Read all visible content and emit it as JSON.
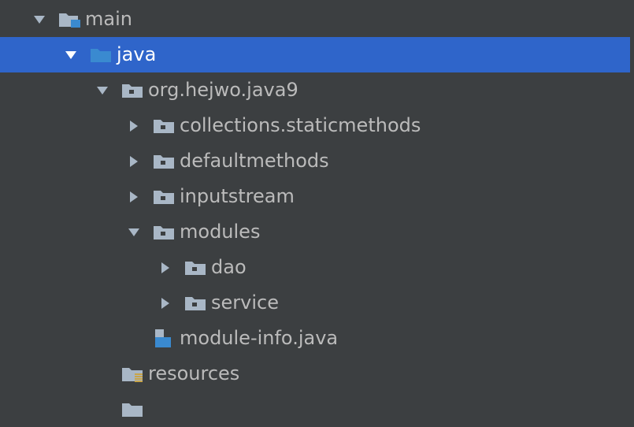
{
  "project_tree": {
    "colors": {
      "background": "#3c3f41",
      "text": "#bbbbbb",
      "selected_background": "#2f65ca",
      "selected_text": "#ffffff",
      "arrow": "#a9b7c6",
      "folder": "#a9b7c6",
      "source_folder": "#3a8ad0",
      "resources_stripe": "#c9a548"
    },
    "nodes": [
      {
        "label": "main",
        "depth": 0,
        "arrow": "expanded",
        "icon": "module-folder-icon",
        "selected": false
      },
      {
        "label": "java",
        "depth": 1,
        "arrow": "expanded",
        "icon": "source-folder-icon",
        "selected": true
      },
      {
        "label": "org.hejwo.java9",
        "depth": 2,
        "arrow": "expanded",
        "icon": "package-icon",
        "selected": false
      },
      {
        "label": "collections.staticmethods",
        "depth": 3,
        "arrow": "collapsed",
        "icon": "package-icon",
        "selected": false
      },
      {
        "label": "defaultmethods",
        "depth": 3,
        "arrow": "collapsed",
        "icon": "package-icon",
        "selected": false
      },
      {
        "label": "inputstream",
        "depth": 3,
        "arrow": "collapsed",
        "icon": "package-icon",
        "selected": false
      },
      {
        "label": "modules",
        "depth": 3,
        "arrow": "expanded",
        "icon": "package-icon",
        "selected": false
      },
      {
        "label": "dao",
        "depth": 4,
        "arrow": "collapsed",
        "icon": "package-icon",
        "selected": false
      },
      {
        "label": "service",
        "depth": 4,
        "arrow": "collapsed",
        "icon": "package-icon",
        "selected": false
      },
      {
        "label": "module-info.java",
        "depth": 3,
        "arrow": "none",
        "icon": "java-module-file-icon",
        "selected": false
      },
      {
        "label": "resources",
        "depth": 2,
        "arrow": "none",
        "icon": "resources-folder-icon",
        "selected": false
      },
      {
        "label": "",
        "depth": 2,
        "arrow": "none",
        "icon": "folder-icon",
        "selected": false
      }
    ]
  }
}
